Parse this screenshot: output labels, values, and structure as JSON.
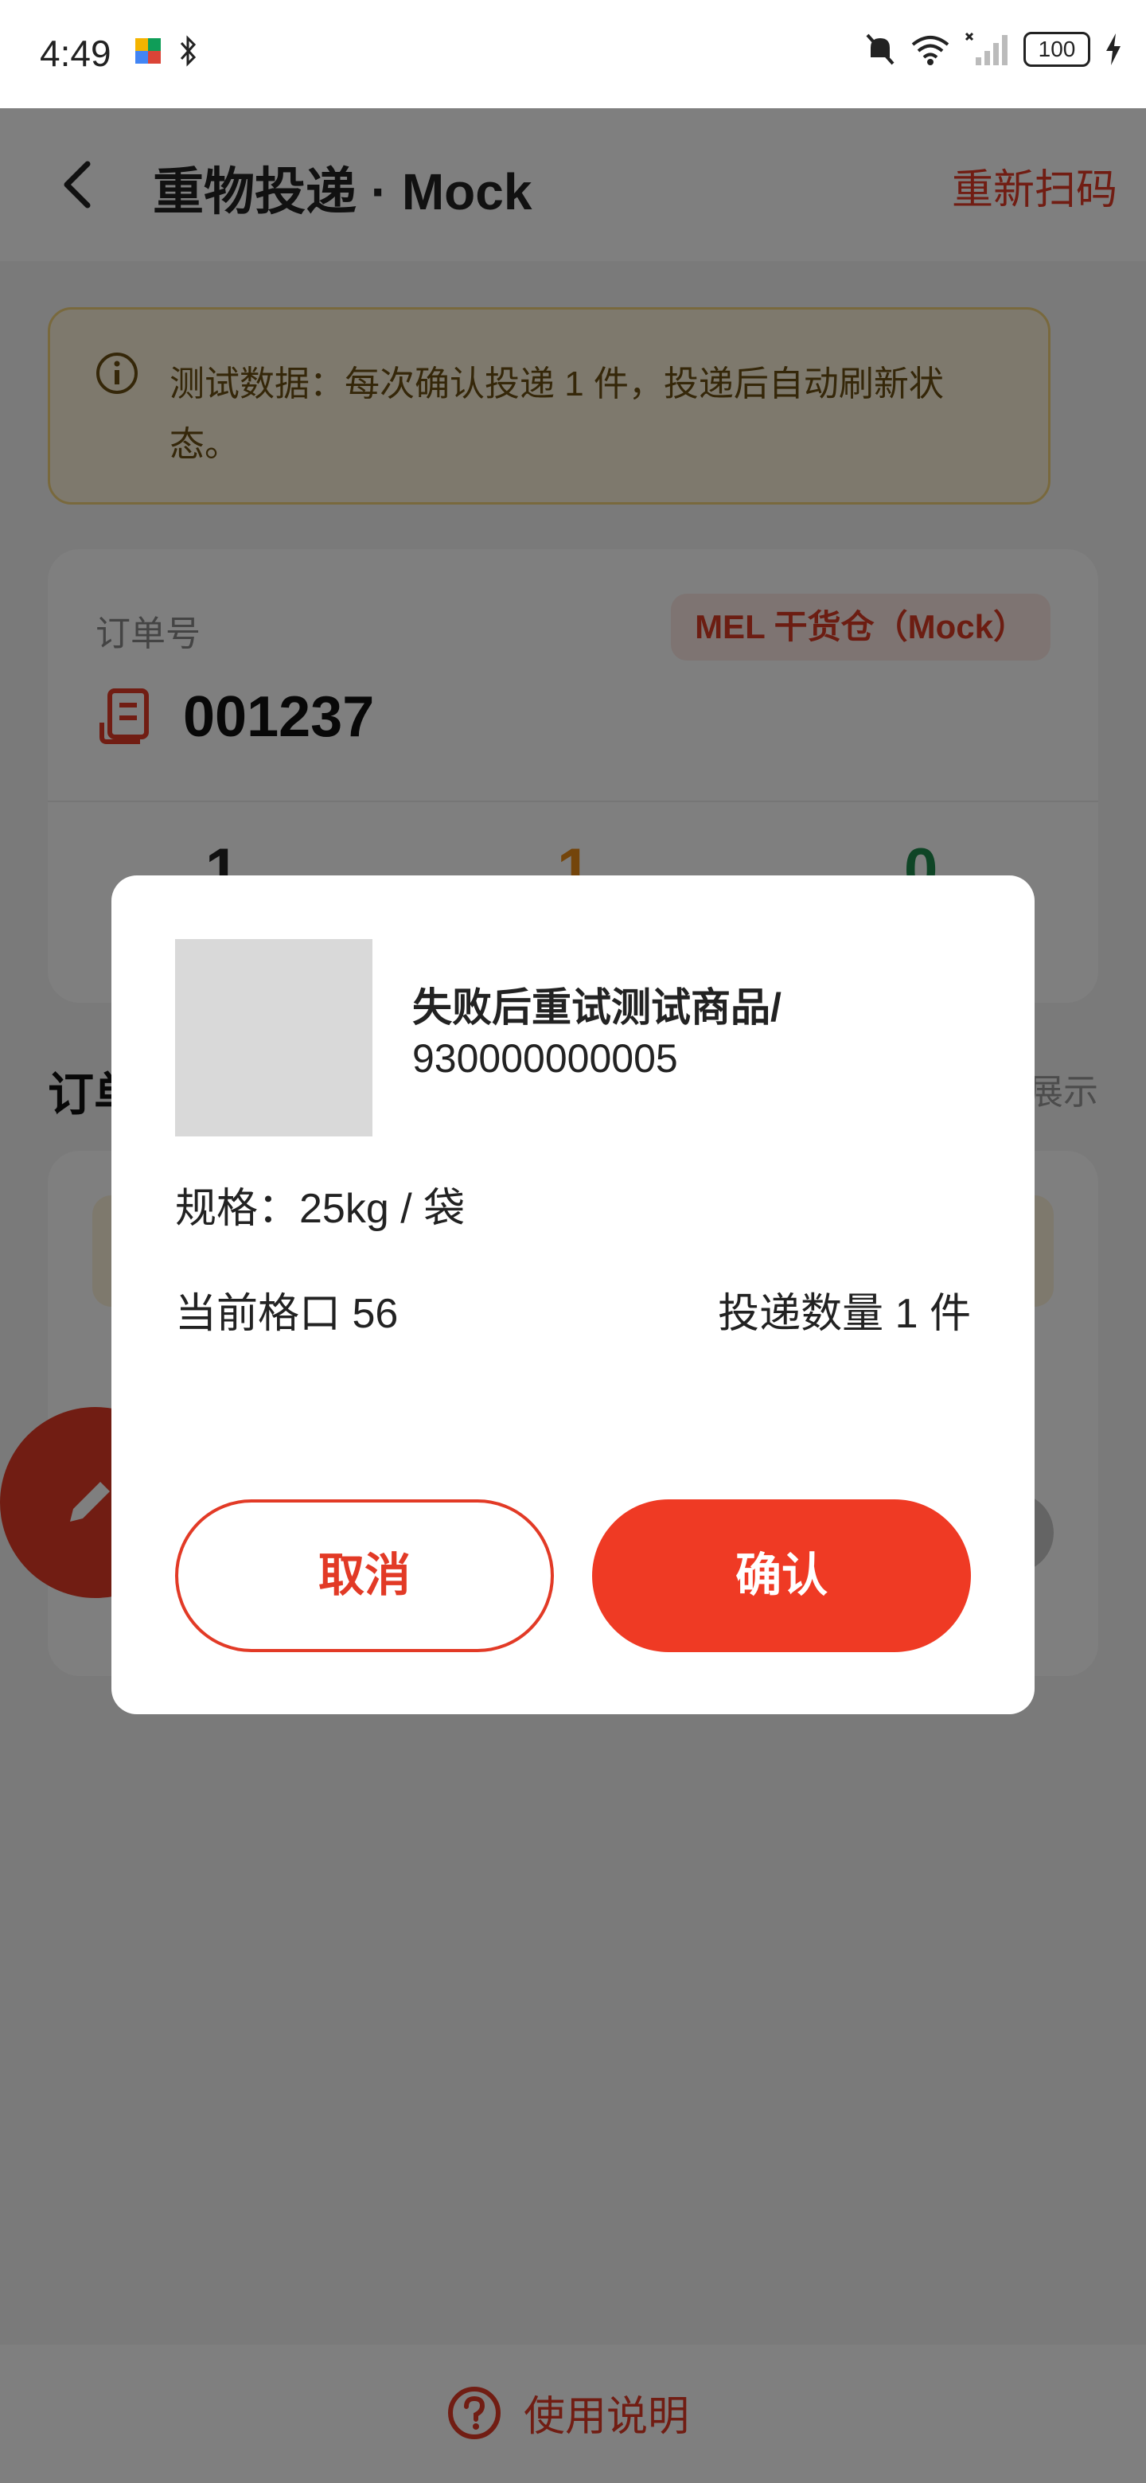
{
  "status_bar": {
    "time": "4:49",
    "battery": "100"
  },
  "header": {
    "title": "重物投递 · Mock",
    "rescan_label": "重新扫码"
  },
  "notice": {
    "text": "测试数据：每次确认投递 1 件，投递后自动刷新状态。"
  },
  "order": {
    "label": "订单号",
    "number": "001237",
    "warehouse": "MEL 干货仓（Mock）",
    "stats": [
      "1",
      "1",
      "0"
    ]
  },
  "section": {
    "title": "订单",
    "action": "展示"
  },
  "dialog": {
    "product_name": "失败后重试测试商品/",
    "product_code": "930000000005",
    "spec": "规格：25kg / 袋",
    "slot": "当前格口 56",
    "quantity": "投递数量 1 件",
    "cancel_label": "取消",
    "confirm_label": "确认"
  },
  "footer": {
    "help_label": "使用说明"
  },
  "colors": {
    "accent": "#e23a26",
    "notice_bg": "#fdf3da",
    "stat_1": "#222222",
    "stat_2": "#e88a17",
    "stat_3": "#1f8a4c"
  },
  "icons": {
    "back": "back-arrow-icon",
    "info": "info-icon",
    "order": "receipt-icon",
    "help": "question-circle-icon",
    "edit": "pencil-icon"
  }
}
